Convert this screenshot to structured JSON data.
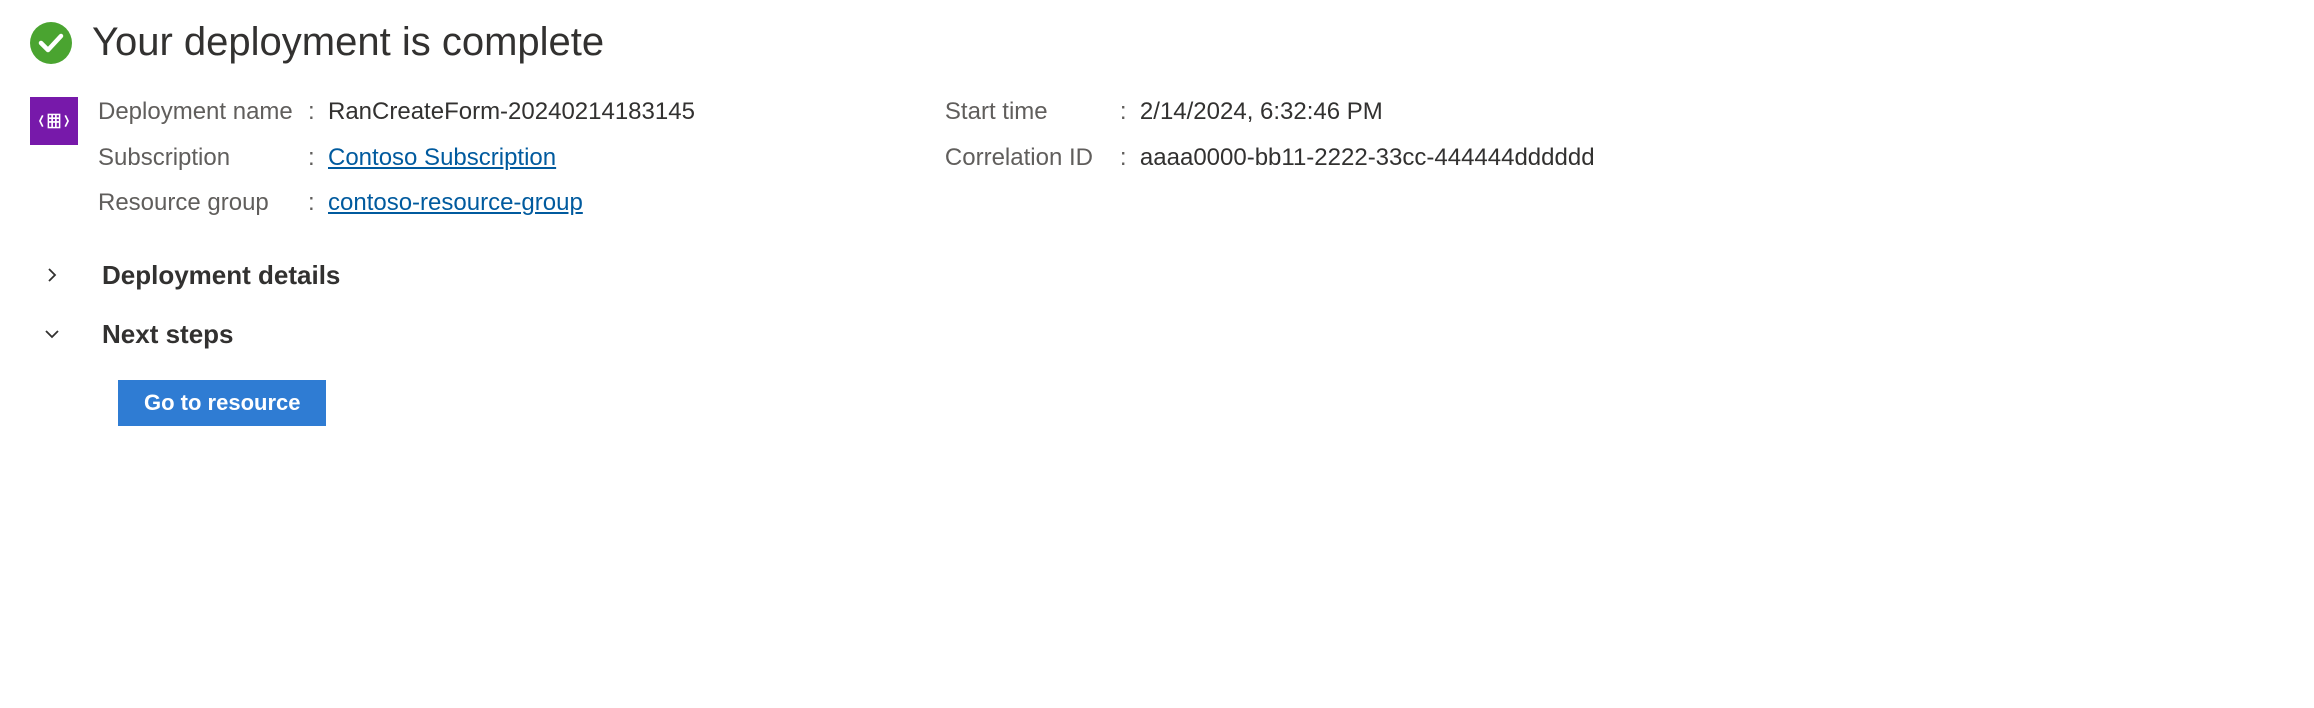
{
  "header": {
    "title": "Your deployment is complete"
  },
  "details": {
    "deployment_name_label": "Deployment name",
    "deployment_name_value": "RanCreateForm-20240214183145",
    "subscription_label": "Subscription",
    "subscription_value": "Contoso Subscription",
    "resource_group_label": "Resource group",
    "resource_group_value": "contoso-resource-group",
    "start_time_label": "Start time",
    "start_time_value": "2/14/2024, 6:32:46 PM",
    "correlation_id_label": "Correlation ID",
    "correlation_id_value": "aaaa0000-bb11-2222-33cc-444444dddddd"
  },
  "sections": {
    "deployment_details": "Deployment details",
    "next_steps": "Next steps"
  },
  "buttons": {
    "go_to_resource": "Go to resource"
  }
}
